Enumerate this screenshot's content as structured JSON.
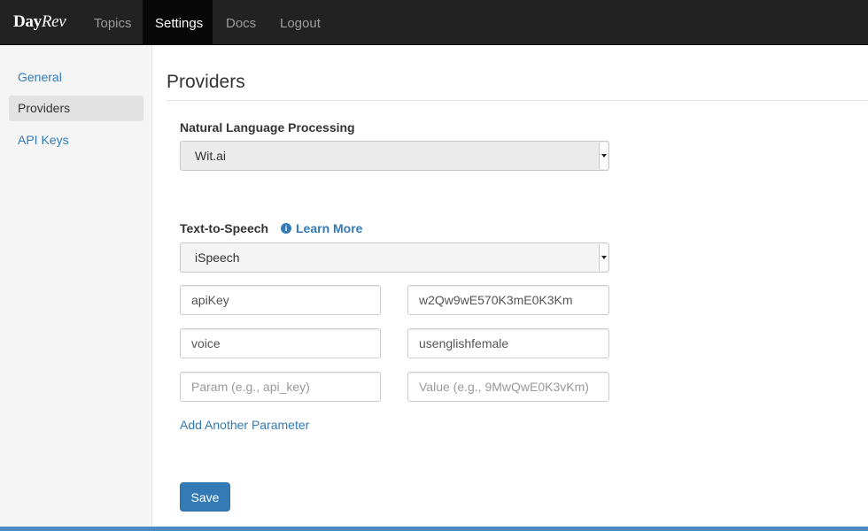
{
  "navbar": {
    "brand_day": "Day",
    "brand_rev": "Rev",
    "items": [
      {
        "label": "Topics",
        "active": false
      },
      {
        "label": "Settings",
        "active": true
      },
      {
        "label": "Docs",
        "active": false
      },
      {
        "label": "Logout",
        "active": false
      }
    ]
  },
  "sidebar": {
    "items": [
      {
        "label": "General",
        "active": false
      },
      {
        "label": "Providers",
        "active": true
      },
      {
        "label": "API Keys",
        "active": false
      }
    ]
  },
  "main": {
    "title": "Providers",
    "nlp": {
      "label": "Natural Language Processing",
      "selected": "Wit.ai"
    },
    "tts": {
      "label": "Text-to-Speech",
      "learn_more": "Learn More",
      "info_icon": "info-circle-icon",
      "selected": "iSpeech",
      "params": [
        {
          "key": "apiKey",
          "value": "w2Qw9wE570K3mE0K3Km"
        },
        {
          "key": "voice",
          "value": "usenglishfemale"
        }
      ],
      "new_param": {
        "key_placeholder": "Param (e.g., api_key)",
        "value_placeholder": "Value (e.g., 9MwQwE0K3vKm)"
      },
      "add_param_label": "Add Another Parameter"
    },
    "save_label": "Save"
  },
  "colors": {
    "navbar_bg": "#222222",
    "link": "#337ab7",
    "primary_button": "#337ab7"
  }
}
